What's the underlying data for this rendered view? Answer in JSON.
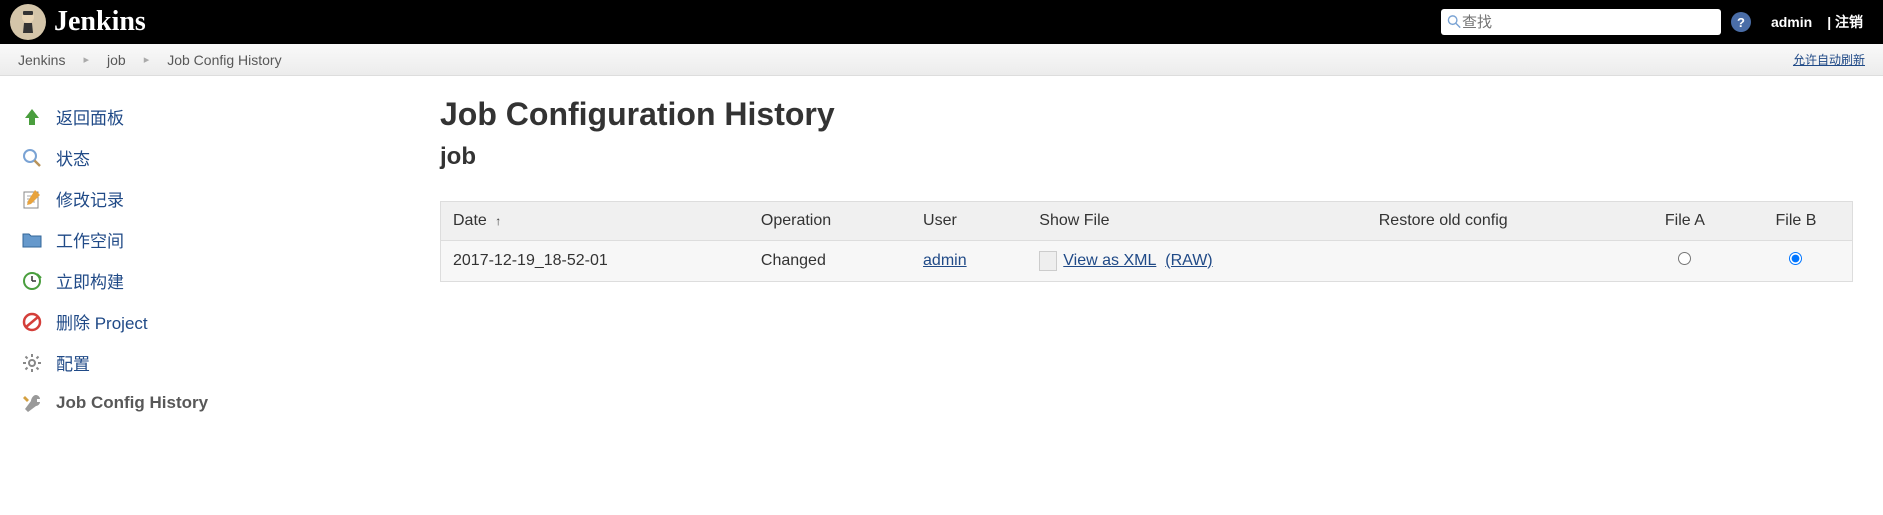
{
  "header": {
    "title": "Jenkins",
    "search_placeholder": "查找",
    "help_symbol": "?",
    "user": "admin",
    "logout": "| 注销"
  },
  "breadcrumb": {
    "items": [
      "Jenkins",
      "job",
      "Job Config History"
    ],
    "separator": "▸",
    "auto_refresh": "允许自动刷新"
  },
  "sidebar": {
    "items": [
      {
        "label": "返回面板",
        "icon": "up-arrow"
      },
      {
        "label": "状态",
        "icon": "search"
      },
      {
        "label": "修改记录",
        "icon": "notepad"
      },
      {
        "label": "工作空间",
        "icon": "folder"
      },
      {
        "label": "立即构建",
        "icon": "clock"
      },
      {
        "label": "删除 Project",
        "icon": "forbidden"
      },
      {
        "label": "配置",
        "icon": "gear"
      },
      {
        "label": "Job Config History",
        "icon": "wrench"
      }
    ]
  },
  "content": {
    "title": "Job Configuration History",
    "subtitle": "job",
    "columns": {
      "date": "Date",
      "operation": "Operation",
      "user": "User",
      "show_file": "Show File",
      "restore": "Restore old config",
      "file_a": "File A",
      "file_b": "File B"
    },
    "sort_indicator": "↑",
    "rows": [
      {
        "date": "2017-12-19_18-52-01",
        "operation": "Changed",
        "user": "admin",
        "view_xml": "View as XML",
        "raw": "(RAW)"
      }
    ]
  }
}
